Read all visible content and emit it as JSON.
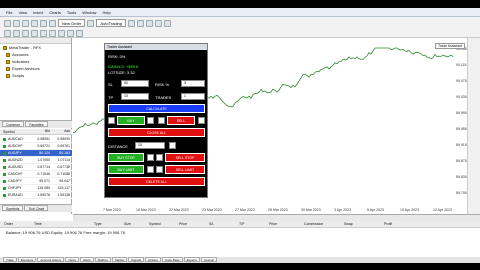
{
  "window": {
    "menu": [
      "File",
      "View",
      "Insert",
      "Charts",
      "Tools",
      "Window",
      "Help"
    ]
  },
  "toolbar": {
    "new_order": "New Order",
    "autotrading": "AutoTrading"
  },
  "navigator": {
    "items": [
      "MetaTrader - RFX",
      "Accounts",
      "Indicators",
      "Expert Advisors",
      "Scripts"
    ],
    "tabs": [
      "Common",
      "Favorites"
    ]
  },
  "market_watch": {
    "headers": [
      "Symbol",
      "Bid",
      "Ask"
    ],
    "rows": [
      {
        "symbol": "AUDCAD",
        "bid": "0.98051",
        "ask": "0.98090"
      },
      {
        "symbol": "AUDCHF",
        "bid": "0.69721",
        "ask": "0.69761"
      },
      {
        "symbol": "AUDJPY",
        "bid": "80.124",
        "ask": "80.163"
      },
      {
        "symbol": "AUDNZD",
        "bid": "1.07050",
        "ask": "1.07114"
      },
      {
        "symbol": "AUDUSD",
        "bid": "0.67714",
        "ask": "0.67738"
      },
      {
        "symbol": "CADCHF",
        "bid": "0.71046",
        "ask": "0.71088"
      },
      {
        "symbol": "CADJPY",
        "bid": "95.071",
        "ask": "95.047"
      },
      {
        "symbol": "CHFJPY",
        "bid": "115.080",
        "ask": "115.117"
      },
      {
        "symbol": "EURAUD",
        "bid": "1.59076",
        "ask": "1.59138"
      }
    ],
    "selected_index": 2,
    "tabs": [
      "Symbols",
      "Tick Chart"
    ]
  },
  "trade_assistant": {
    "title": "Trader Assistant",
    "risk": "RISK: 3%",
    "gain": "GAIN/LS: +$99.6",
    "lotsize": "LOTSIZE: 3.32",
    "sl_label": "SL",
    "sl_value": "50",
    "risk_label": "RISK %",
    "risk_value": "3",
    "tp_label": "TP",
    "tp_value": "10",
    "trades_label": "TRADES",
    "trades_value": "1",
    "calculate": "CALCULATE",
    "buy": "BUY",
    "sell": "SELL",
    "close_all": "CLOSE ALL",
    "distance_label": "DISTANCE",
    "distance_value": "10",
    "buy_stop": "BUY STOP",
    "sell_stop": "SELL STOP",
    "buy_limit": "BUY LIMIT",
    "sell_limit": "SELL LIMIT",
    "delete_all": "DELETE ALL"
  },
  "chart": {
    "label": "Trade Assistant",
    "dates": [
      "7 Mar 2023",
      "16 Mar 2023",
      "22 Mar 2023",
      "23 Mar 2023",
      "27 Mar 2023",
      "28 Mar 2023",
      "30 Mar 2023",
      "3 Apr 2023",
      "5 Apr 2023",
      "10 Apr 2023",
      "12 Apr 2023"
    ],
    "prices": [
      "90.155",
      "90.115",
      "90.075",
      "90.035",
      "89.995",
      "89.955",
      "89.915",
      "89.875",
      "89.835",
      "89.795"
    ]
  },
  "terminal": {
    "headers": [
      "Order",
      "Time",
      "Type",
      "Size",
      "Symbol",
      "Price",
      "S/L",
      "T/P",
      "Price",
      "Commission",
      "Swap",
      "Profit"
    ],
    "balance": "Balance: 19 906.76 USD  Equity: 19 906.76  Free margin: 19 906.76",
    "tabs": [
      "Trade",
      "Exposure",
      "Account History",
      "News",
      "Alerts",
      "Mailbox",
      "Market",
      "Signals",
      "Articles",
      "Code Base",
      "Experts",
      "Journal"
    ]
  },
  "colors": {
    "panel_bg": "#000000",
    "calc_blue": "#1a3cff",
    "buy_green": "#22b022",
    "sell_red": "#e01010",
    "chart_line": "#2e8b2e"
  }
}
